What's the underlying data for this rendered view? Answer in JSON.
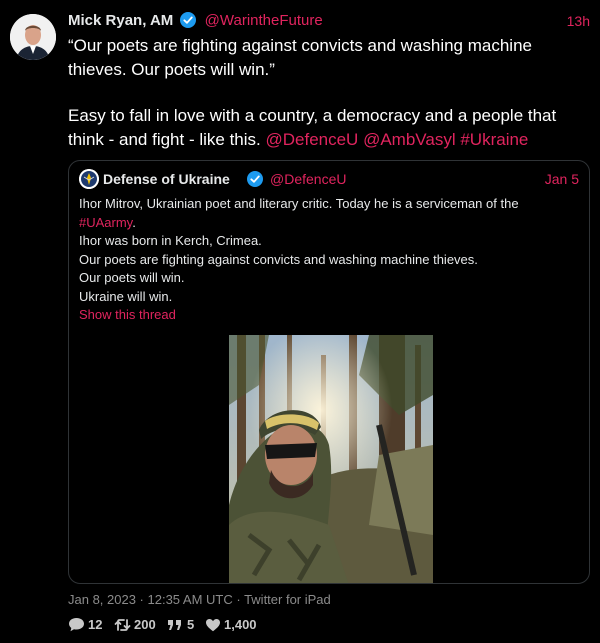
{
  "tweet": {
    "author_name": "Mick Ryan, AM",
    "author_handle": "@WarintheFuture",
    "time_ago": "13h",
    "body_line1": "“Our poets are fighting against convicts and washing machine thieves. Our poets will win.”",
    "body_line2_text": "Easy to fall in love with a country, a democracy and a people that think - and fight - like this. ",
    "mention1": "@DefenceU",
    "mention2": "@AmbVasyl",
    "hashtag": "#Ukraine",
    "timestamp": "Jan 8, 2023 · 12:35 AM UTC · Twitter for iPad",
    "replies": "12",
    "retweets": "200",
    "quotes": "5",
    "likes": "1,400"
  },
  "quoted": {
    "author_name": "Defense of Ukraine",
    "author_handle": "@DefenceU",
    "date": "Jan 5",
    "line1": "Ihor Mitrov, Ukrainian poet and literary critic. Today he is a serviceman of the",
    "hashtag": "#UAarmy",
    "hashtag_suffix": ".",
    "line2": "Ihor was born in Kerch, Crimea.",
    "line3": "Our poets are fighting against convicts and washing machine thieves.",
    "line4": "Our poets will win.",
    "line5": "Ukraine will win.",
    "show_thread": "Show this thread"
  },
  "colors": {
    "accent": "#e0245e",
    "verified": "#1d9bf0",
    "background": "#000000",
    "border": "#2f3336"
  },
  "icons": [
    "verified-badge-icon",
    "reply-icon",
    "retweet-icon",
    "quote-icon",
    "like-icon"
  ]
}
